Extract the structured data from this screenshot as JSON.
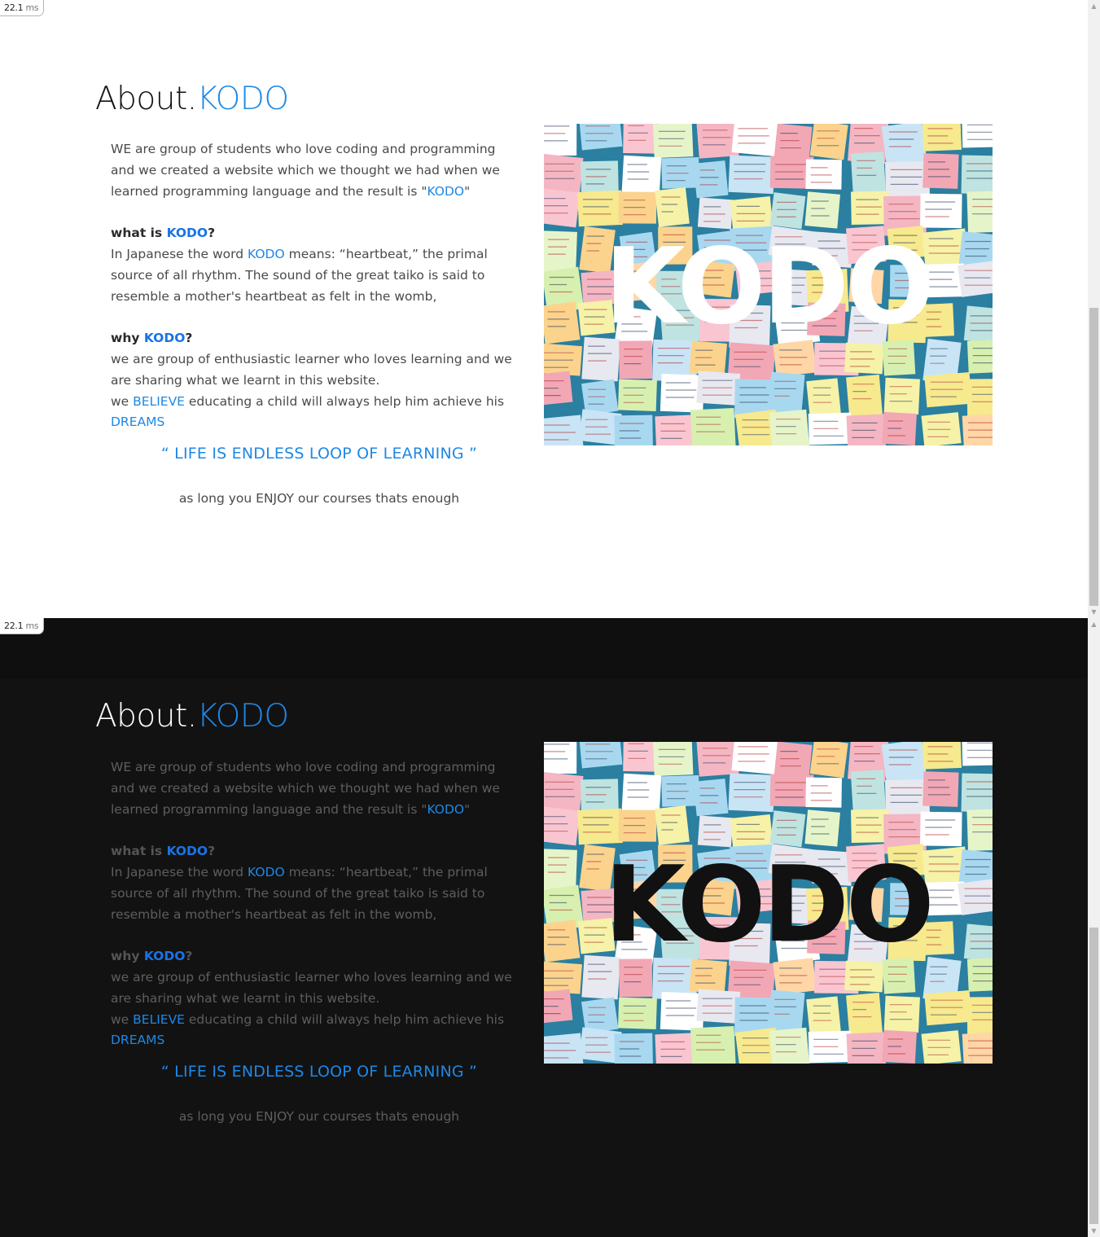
{
  "timer": {
    "value": "22.1",
    "unit": "ms"
  },
  "about": {
    "title_prefix": "About.",
    "title_brand": "KODO",
    "intro_line1": "WE are group of students who love coding and programming",
    "intro_line2": "and we created a website which we thought we had when we",
    "intro_line3_a": "learned programming language and the result is \"",
    "intro_line3_brand": "KODO",
    "intro_line3_b": "\"",
    "what_label": "what is ",
    "what_brand": "KODO",
    "what_suffix": "?",
    "what_line1_a": "In Japanese the word ",
    "what_line1_brand": "KODO",
    "what_line1_b": " means: “heartbeat,” the primal",
    "what_line2": "source of all rhythm. The sound of the great taiko is said to",
    "what_line3": "resemble a mother's heartbeat as felt in the womb,",
    "why_label": "why ",
    "why_brand": "KODO",
    "why_suffix": "?",
    "why_line1": "we are group of enthusiastic learner who loves learning and we",
    "why_line2": "are sharing what we learnt in this website.",
    "why_line3_a": "we ",
    "why_line3_believe": "BELIEVE",
    "why_line3_b": " educating a child will always help him achieve his",
    "why_line4_dreams": "DREAMS",
    "quote": "“ LIFE IS ENDLESS LOOP OF LEARNING ”",
    "closing_a": "as long you ",
    "closing_enjoy": "ENJOY",
    "closing_b": " our courses thats enough",
    "image_logo_text": "KODO"
  },
  "colors": {
    "accent": "#1e88e5",
    "dark_bg": "#121212",
    "light_bg": "#ffffff"
  },
  "icons": {
    "scroll_up": "scroll-up-arrow-icon",
    "scroll_down": "scroll-down-arrow-icon"
  }
}
